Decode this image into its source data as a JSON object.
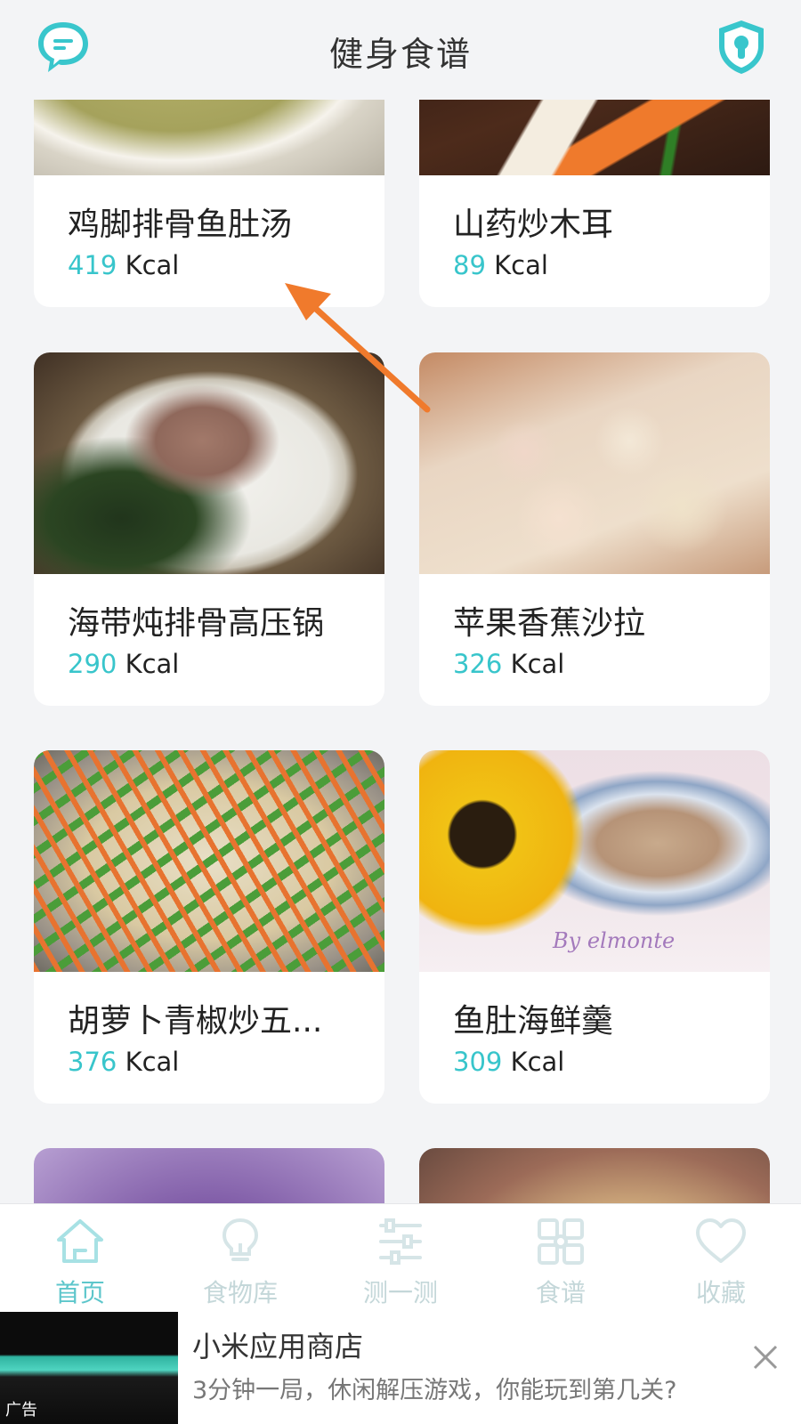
{
  "header": {
    "title": "健身食谱",
    "left_icon": "chat-bubble-icon",
    "right_icon": "shield-lock-icon"
  },
  "recipes": [
    {
      "name": "鸡脚排骨鱼肚汤",
      "kcal": "419",
      "unit": "Kcal"
    },
    {
      "name": "山药炒木耳",
      "kcal": "89",
      "unit": "Kcal"
    },
    {
      "name": "海带炖排骨高压锅",
      "kcal": "290",
      "unit": "Kcal"
    },
    {
      "name": "苹果香蕉沙拉",
      "kcal": "326",
      "unit": "Kcal"
    },
    {
      "name": "胡萝卜青椒炒五...",
      "kcal": "376",
      "unit": "Kcal"
    },
    {
      "name": "鱼肚海鲜羹",
      "kcal": "309",
      "unit": "Kcal"
    }
  ],
  "image_watermark": "By elmonte",
  "tabs": [
    {
      "label": "首页",
      "icon": "home-icon",
      "active": true
    },
    {
      "label": "食物库",
      "icon": "lightbulb-icon",
      "active": false
    },
    {
      "label": "测一测",
      "icon": "sliders-icon",
      "active": false
    },
    {
      "label": "食谱",
      "icon": "grid-icon",
      "active": false
    },
    {
      "label": "收藏",
      "icon": "heart-icon",
      "active": false
    }
  ],
  "ad": {
    "tag": "广告",
    "app_name": "小米应用商店",
    "description": "3分钟一局，休闲解压游戏，你能玩到第几关?"
  },
  "colors": {
    "accent": "#38c5cb",
    "tab_inactive": "#c4d7d9",
    "background": "#f3f4f6",
    "annotation_arrow": "#f07a2c"
  }
}
